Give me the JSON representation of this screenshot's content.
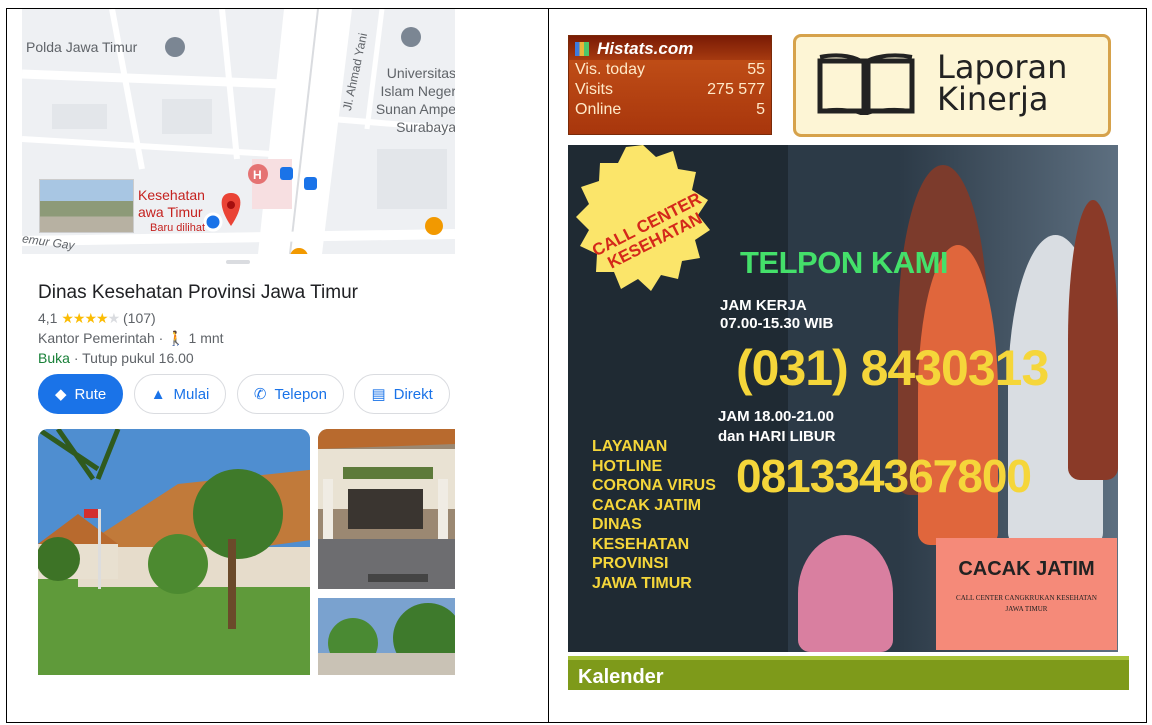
{
  "maps": {
    "labels": {
      "polda": "Polda Jawa Timur",
      "university": "Universitas Islam Negeri Sunan Ampel Surabaya",
      "university_lines": [
        "Universitas",
        "Islam Neger",
        "Sunan Ampe",
        "Surabaya"
      ],
      "road": "Jl. Ahmad Yani",
      "poi_lines": [
        "Kesehatan",
        "awa Timur"
      ],
      "poi_sub": "Baru dilihat",
      "street": "emur Gay"
    },
    "place": {
      "title": "Dinas Kesehatan Provinsi Jawa Timur",
      "rating": "4,1",
      "reviews": "(107)",
      "category": "Kantor Pemerintah",
      "walk": "1 mnt",
      "status": "Buka",
      "hours": "Tutup pukul 16.00"
    },
    "buttons": {
      "route": "Rute",
      "start": "Mulai",
      "call": "Telepon",
      "directory": "Direkt"
    }
  },
  "histats": {
    "brand": "Histats.com",
    "rows": [
      {
        "label": "Vis. today",
        "value": "55"
      },
      {
        "label": "Visits",
        "value": "275 577"
      },
      {
        "label": "Online",
        "value": "5"
      }
    ]
  },
  "laporan": {
    "line1": "Laporan",
    "line2": "Kinerja"
  },
  "poster": {
    "badge": [
      "CALL CENTER",
      "KESEHATAN"
    ],
    "headline": "TELPON KAMI",
    "work_hours": [
      "JAM KERJA",
      "07.00-15.30 WIB"
    ],
    "phone_office": "(031) 8430313",
    "after_hours": [
      "JAM 18.00-21.00",
      "dan HARI LIBUR"
    ],
    "phone_mobile": "081334367800",
    "service_lines": [
      "LAYANAN",
      "HOTLINE",
      "CORONA VIRUS",
      "CACAK JATIM",
      "DINAS",
      "KESEHATAN",
      "PROVINSI",
      "JAWA TIMUR"
    ],
    "cacak_title": "CACAK JATIM",
    "cacak_sub": [
      "CALL CENTER CANGKRUKAN KESEHATAN",
      "JAWA TIMUR"
    ]
  },
  "kalender": {
    "title": "Kalender"
  },
  "colors": {
    "maps_blue": "#1a73e8",
    "open_green": "#188038",
    "star_yellow": "#fbbc04",
    "poster_green": "#44e06a",
    "poster_yellow": "#f5d63a",
    "kalender_green": "#7e9a1a"
  }
}
